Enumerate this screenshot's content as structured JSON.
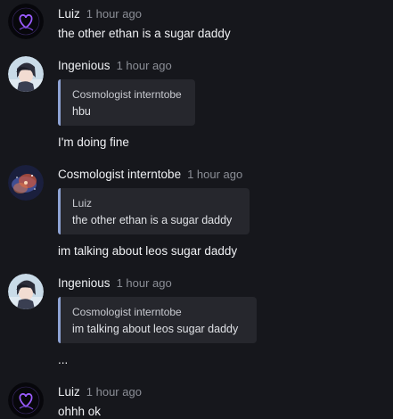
{
  "messages": [
    {
      "author": "Luiz",
      "time": "1 hour ago",
      "avatar_icon": "purple-heart-icon",
      "text": "the other ethan is a sugar daddy"
    },
    {
      "author": "Ingenious",
      "time": "1 hour ago",
      "avatar_icon": "anime-character-avatar",
      "quote": {
        "author": "Cosmologist interntobe",
        "text": "hbu"
      },
      "text": "I'm doing fine"
    },
    {
      "author": "Cosmologist interntobe",
      "time": "1 hour ago",
      "avatar_icon": "nebula-avatar",
      "quote": {
        "author": "Luiz",
        "text": "the other ethan is a sugar daddy"
      },
      "text": "im talking about leos sugar daddy"
    },
    {
      "author": "Ingenious",
      "time": "1 hour ago",
      "avatar_icon": "anime-character-avatar",
      "quote": {
        "author": "Cosmologist interntobe",
        "text": "im talking about leos sugar daddy"
      },
      "text": "..."
    },
    {
      "author": "Luiz",
      "time": "1 hour ago",
      "avatar_icon": "purple-heart-icon",
      "text": "ohhh ok"
    }
  ],
  "colors": {
    "background": "#16171c",
    "quote_background": "#26272d",
    "quote_accent": "#8ea3d4",
    "heart_purple": "#9b5cff",
    "timestamp": "#8b8e96"
  }
}
